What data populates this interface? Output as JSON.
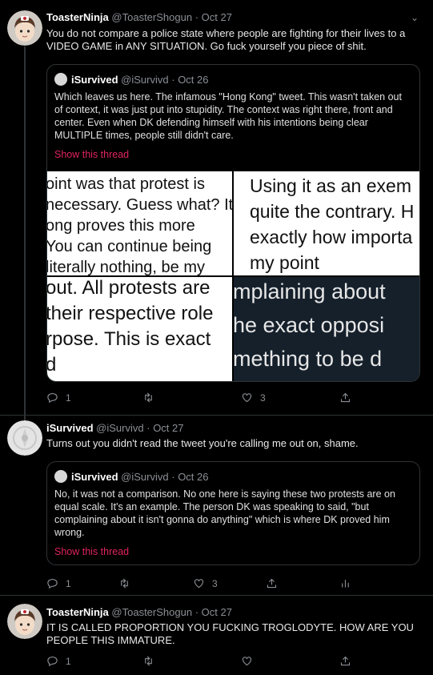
{
  "tweets": [
    {
      "name": "ToasterNinja",
      "handle": "@ToasterShogun",
      "dot": "·",
      "date": "Oct 27",
      "text": "You do not compare a police state where people are fighting for their lives to a VIDEO GAME in ANY SITUATION. Go fuck yourself you piece of shit.",
      "quote": {
        "name": "iSurvived",
        "handle": "@iSurvivd",
        "date": "Oct 26",
        "text": "Which leaves us here. The infamous \"Hong Kong\" tweet. This wasn't taken out of context, it was just put into stupidity. The context was right there, front and center. Even when DK defending himself with his intentions being clear MULTIPLE times, people still didn't care.",
        "show_thread": "Show this thread",
        "images": [
          {
            "lines": [
              "oint was that protest is",
              "necessary. Guess what? It",
              "ong proves this more",
              "You can continue being",
              "literally nothing, be my"
            ]
          },
          {
            "lines": [
              "Using it as an exem",
              "quite the contrary. H",
              "exactly how importa",
              "my point"
            ]
          },
          {
            "lines": [
              "out. All protests are",
              "their respective role",
              "rpose. This is exact",
              "d"
            ]
          },
          {
            "lines": [
              "mplaining about",
              "he exact opposi",
              "mething to be d"
            ]
          }
        ]
      },
      "replies": "1",
      "retweets": "",
      "likes": "3"
    },
    {
      "name": "iSurvived",
      "handle": "@iSurvivd",
      "dot": "·",
      "date": "Oct 27",
      "text": "Turns out you didn't read the tweet you're calling me out on, shame.",
      "quote": {
        "name": "iSurvived",
        "handle": "@iSurvivd",
        "date": "Oct 26",
        "text": "No, it was not a comparison. No one here is saying these two protests are on equal scale. It's an example. The person DK was speaking to said, \"but complaining about it isn't gonna do anything\" which is where DK proved him wrong.",
        "show_thread": "Show this thread"
      },
      "replies": "1",
      "retweets": "",
      "likes": "3"
    },
    {
      "name": "ToasterNinja",
      "handle": "@ToasterShogun",
      "dot": "·",
      "date": "Oct 27",
      "text": "IT IS CALLED PROPORTION YOU FUCKING TROGLODYTE. HOW ARE YOU PEOPLE THIS IMMATURE.",
      "replies": "1",
      "retweets": "",
      "likes": ""
    }
  ],
  "colors": {
    "background": "#000000",
    "muted": "#8b8f94",
    "accent": "#e0245e",
    "border": "#2f3336"
  },
  "icons": [
    "reply-icon",
    "retweet-icon",
    "like-icon",
    "share-icon",
    "analytics-icon",
    "chevron-down-icon"
  ]
}
